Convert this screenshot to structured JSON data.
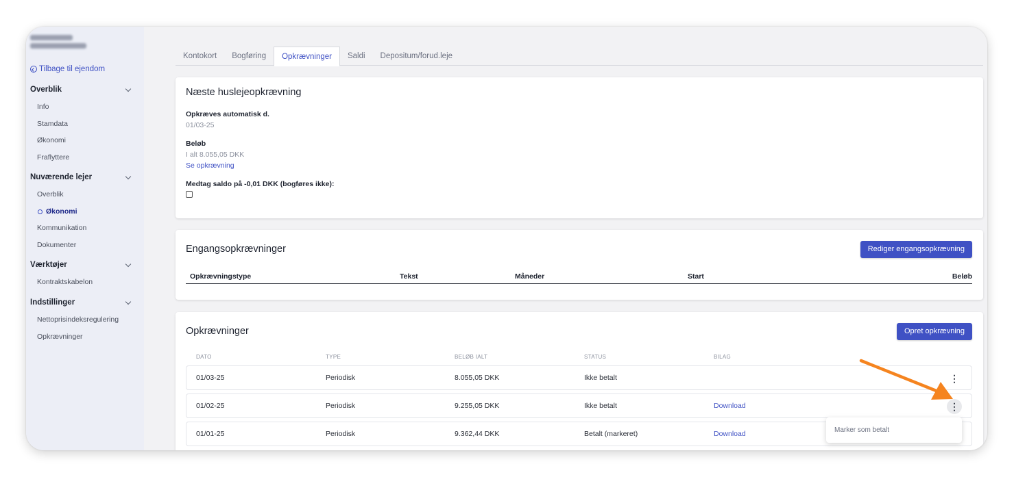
{
  "sidebar": {
    "back_label": "Tilbage til ejendom",
    "groups": [
      {
        "title": "Overblik",
        "items": [
          "Info",
          "Stamdata",
          "Økonomi",
          "Fraflyttere"
        ]
      },
      {
        "title": "Nuværende lejer",
        "items": [
          "Overblik",
          "Økonomi",
          "Kommunikation",
          "Dokumenter"
        ]
      },
      {
        "title": "Værktøjer",
        "items": [
          "Kontraktskabelon"
        ]
      },
      {
        "title": "Indstillinger",
        "items": [
          "Nettoprisindeksregulering",
          "Opkrævninger"
        ]
      }
    ]
  },
  "tabs": [
    "Kontokort",
    "Bogføring",
    "Opkrævninger",
    "Saldi",
    "Depositum/forud.leje"
  ],
  "next_charge": {
    "title": "Næste huslejeopkrævning",
    "auto_label": "Opkræves automatisk d.",
    "auto_date": "01/03-25",
    "amount_label": "Beløb",
    "amount_value": "I alt 8.055,05 DKK",
    "see_link": "Se opkrævning",
    "balance_label": "Medtag saldo på -0,01 DKK (bogføres ikke):"
  },
  "one_time": {
    "title": "Engangsopkrævninger",
    "button": "Rediger engangsopkrævning",
    "headers": [
      "Opkrævningstype",
      "Tekst",
      "Måneder",
      "Start",
      "Beløb"
    ]
  },
  "charges": {
    "title": "Opkrævninger",
    "button": "Opret opkrævning",
    "headers": [
      "DATO",
      "TYPE",
      "BELØB IALT",
      "STATUS",
      "BILAG"
    ],
    "rows": [
      {
        "date": "01/03-25",
        "type": "Periodisk",
        "amount": "8.055,05 DKK",
        "status": "Ikke betalt",
        "attachment": ""
      },
      {
        "date": "01/02-25",
        "type": "Periodisk",
        "amount": "9.255,05 DKK",
        "status": "Ikke betalt",
        "attachment": "Download"
      },
      {
        "date": "01/01-25",
        "type": "Periodisk",
        "amount": "9.362,44 DKK",
        "status": "Betalt (markeret)",
        "attachment": "Download"
      }
    ],
    "kebab_glyph": "⋮",
    "menu_item": "Marker som betalt"
  },
  "colors": {
    "accent": "#3f51c4",
    "annotation_arrow": "#f5841f"
  }
}
